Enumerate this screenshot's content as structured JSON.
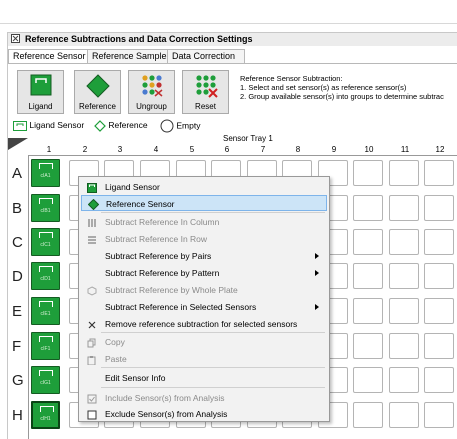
{
  "window": {
    "title": "Reference Subtractions and Data Correction Settings"
  },
  "tabs": [
    "Reference Sensor",
    "Reference Sample",
    "Data Correction"
  ],
  "toolbar": [
    {
      "label": "Ligand",
      "icon": "ligand-icon"
    },
    {
      "label": "Reference",
      "icon": "reference-diamond-icon"
    },
    {
      "label": "Ungroup",
      "icon": "ungroup-icon"
    },
    {
      "label": "Reset",
      "icon": "reset-icon"
    }
  ],
  "description": {
    "title": "Reference Sensor Subtraction:",
    "line1": "1. Select and set sensor(s) as reference sensor(s)",
    "line2": "2. Group available sensor(s) into groups to determine subtrac"
  },
  "legend": {
    "ligand": "Ligand Sensor",
    "reference": "Reference",
    "empty": "Empty"
  },
  "tray": {
    "title": "Sensor Tray 1",
    "columns": [
      "1",
      "2",
      "3",
      "4",
      "5",
      "6",
      "7",
      "8",
      "9",
      "10",
      "11",
      "12"
    ],
    "rows": [
      "A",
      "B",
      "C",
      "D",
      "E",
      "F",
      "G",
      "H"
    ],
    "sensor_ids": [
      "cIA1",
      "cIB1",
      "cIC1",
      "cID1",
      "cIE1",
      "cIF1",
      "cIG1",
      "cIH1"
    ]
  },
  "context_menu": {
    "items": [
      {
        "label": "Ligand Sensor",
        "icon": "ligand-sensor-icon",
        "disabled": false
      },
      {
        "label": "Reference Sensor",
        "icon": "reference-diamond-icon",
        "disabled": false,
        "highlighted": true
      },
      {
        "label": "Subtract Reference In Column",
        "icon": "column-icon",
        "disabled": true
      },
      {
        "label": "Subtract Reference In Row",
        "icon": "row-icon",
        "disabled": true
      },
      {
        "label": "Subtract Reference by Pairs",
        "disabled": false,
        "submenu": true
      },
      {
        "label": "Subtract Reference by Pattern",
        "disabled": false,
        "submenu": true
      },
      {
        "label": "Subtract Reference by Whole Plate",
        "icon": "whole-plate-icon",
        "disabled": true
      },
      {
        "label": "Subtract Reference in Selected Sensors",
        "disabled": false,
        "submenu": true
      },
      {
        "label": "Remove reference subtraction for selected sensors",
        "icon": "close-icon",
        "disabled": false
      },
      {
        "label": "Copy",
        "icon": "copy-icon",
        "disabled": true
      },
      {
        "label": "Paste",
        "icon": "paste-icon",
        "disabled": true
      },
      {
        "label": "Edit Sensor Info",
        "disabled": false
      },
      {
        "label": "Include Sensor(s) from Analysis",
        "icon": "checkbox-checked-icon",
        "disabled": true
      },
      {
        "label": "Exclude Sensor(s) from Analysis",
        "icon": "checkbox-empty-icon",
        "disabled": false
      }
    ]
  },
  "colors": {
    "sensor_green": "#1e9e3a",
    "highlight": "#cce4f7"
  }
}
